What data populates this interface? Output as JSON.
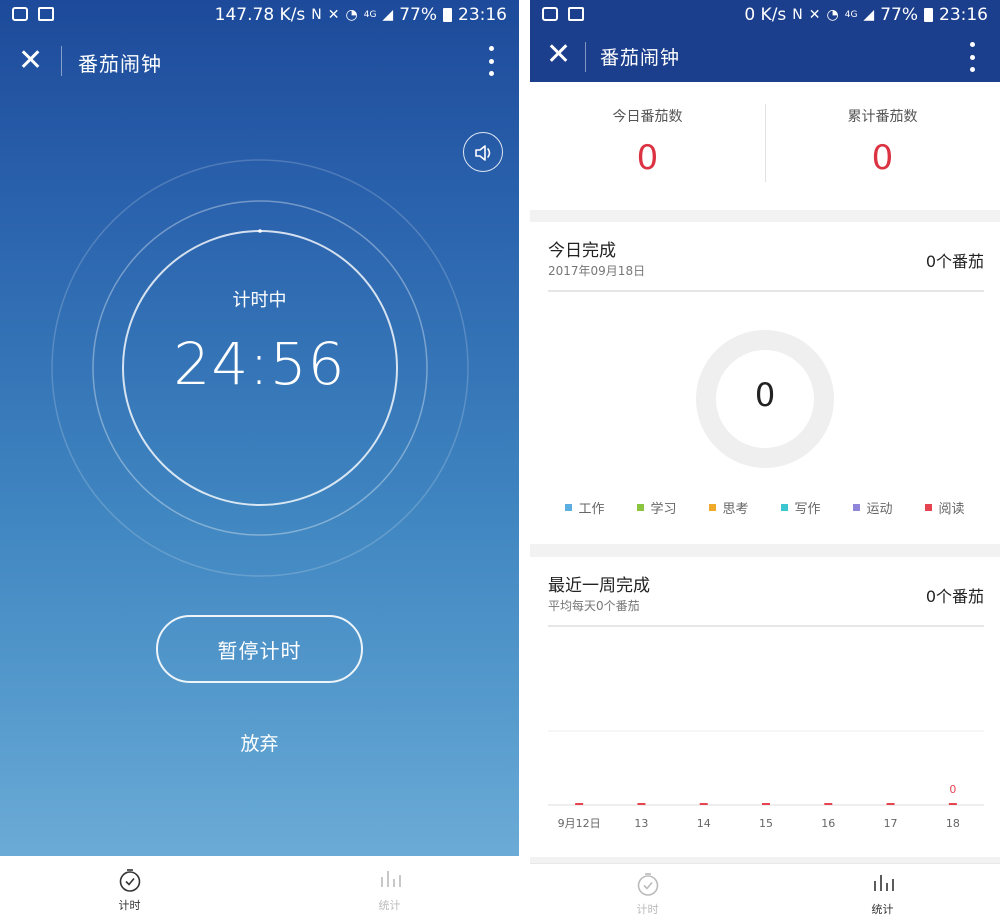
{
  "left": {
    "status": {
      "speed": "147.78 K/s",
      "network": "4G",
      "battery": "77%",
      "time": "23:16"
    },
    "app_bar": {
      "title": "番茄闹钟"
    },
    "timer": {
      "label": "计时中",
      "value": "24:56"
    },
    "buttons": {
      "pause": "暂停计时",
      "give_up": "放弃"
    },
    "tabs": [
      {
        "label": "计时",
        "icon": "stopwatch-icon",
        "active": true
      },
      {
        "label": "统计",
        "icon": "bar-chart-icon",
        "active": false
      }
    ]
  },
  "right": {
    "status": {
      "speed": "0 K/s",
      "network": "4G",
      "battery": "77%",
      "time": "23:16"
    },
    "app_bar": {
      "title": "番茄闹钟"
    },
    "summary": [
      {
        "label": "今日番茄数",
        "value": "0"
      },
      {
        "label": "累计番茄数",
        "value": "0"
      }
    ],
    "today": {
      "title": "今日完成",
      "date": "2017年09月18日",
      "count": "0个番茄",
      "center_value": "0"
    },
    "legend": [
      {
        "name": "工作",
        "color": "#5aaee0"
      },
      {
        "name": "学习",
        "color": "#8bc53f"
      },
      {
        "name": "思考",
        "color": "#f0a92b"
      },
      {
        "name": "写作",
        "color": "#3cc6cf"
      },
      {
        "name": "运动",
        "color": "#8f86d9"
      },
      {
        "name": "阅读",
        "color": "#e54450"
      }
    ],
    "week": {
      "title": "最近一周完成",
      "subtitle": "平均每天0个番茄",
      "count": "0个番茄"
    },
    "tabs": [
      {
        "label": "计时",
        "icon": "stopwatch-icon",
        "active": false
      },
      {
        "label": "统计",
        "icon": "bar-chart-icon",
        "active": true
      }
    ]
  },
  "chart_data": {
    "type": "bar",
    "categories": [
      "9月12日",
      "13",
      "14",
      "15",
      "16",
      "17",
      "18"
    ],
    "values": [
      0,
      0,
      0,
      0,
      0,
      0,
      0
    ],
    "data_labels": [
      null,
      null,
      null,
      null,
      null,
      null,
      "0"
    ],
    "title": "",
    "xlabel": "",
    "ylabel": "",
    "bar_color": "#e54450"
  }
}
